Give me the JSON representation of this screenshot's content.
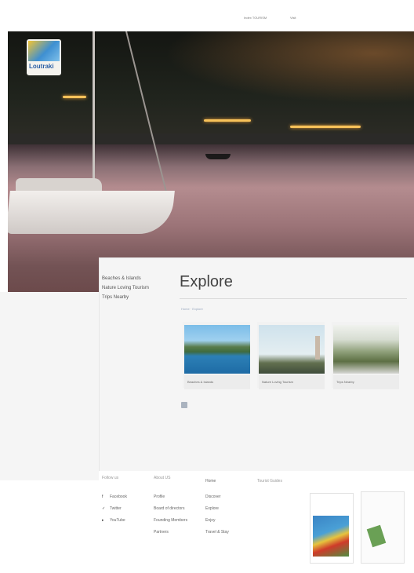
{
  "topbar": {
    "link_a": "Index TOURISM",
    "link_b": "Visit"
  },
  "logo": {
    "text": "Loutraki"
  },
  "side_nav": [
    "Beaches & Islands",
    "Nature Loving Tourism",
    "Trips Nearby"
  ],
  "page_title": "Explore",
  "breadcrumb": "Home · Explore",
  "cards": [
    {
      "caption": "Beaches & Islands"
    },
    {
      "caption": "Nature Loving Tourism"
    },
    {
      "caption": "Trips Nearby"
    }
  ],
  "footer": {
    "follow_heading": "Follow us",
    "social": [
      {
        "icon": "facebook-icon",
        "glyph": "f",
        "label": "Facebook"
      },
      {
        "icon": "twitter-icon",
        "glyph": "✓",
        "label": "Twitter"
      },
      {
        "icon": "youtube-icon",
        "glyph": "▸",
        "label": "YouTube"
      }
    ],
    "about_heading": "About US",
    "about_items": [
      "Profile",
      "Board of directors",
      "Founding Members",
      "Partners"
    ],
    "nav_heading": "Home",
    "nav_items": [
      "Discover",
      "Explore",
      "Enjoy",
      "Travel & Stay"
    ],
    "guides_heading": "Tourist Guides"
  },
  "colors": {
    "accent": "#2a5fa5",
    "panel": "#f5f5f5"
  }
}
